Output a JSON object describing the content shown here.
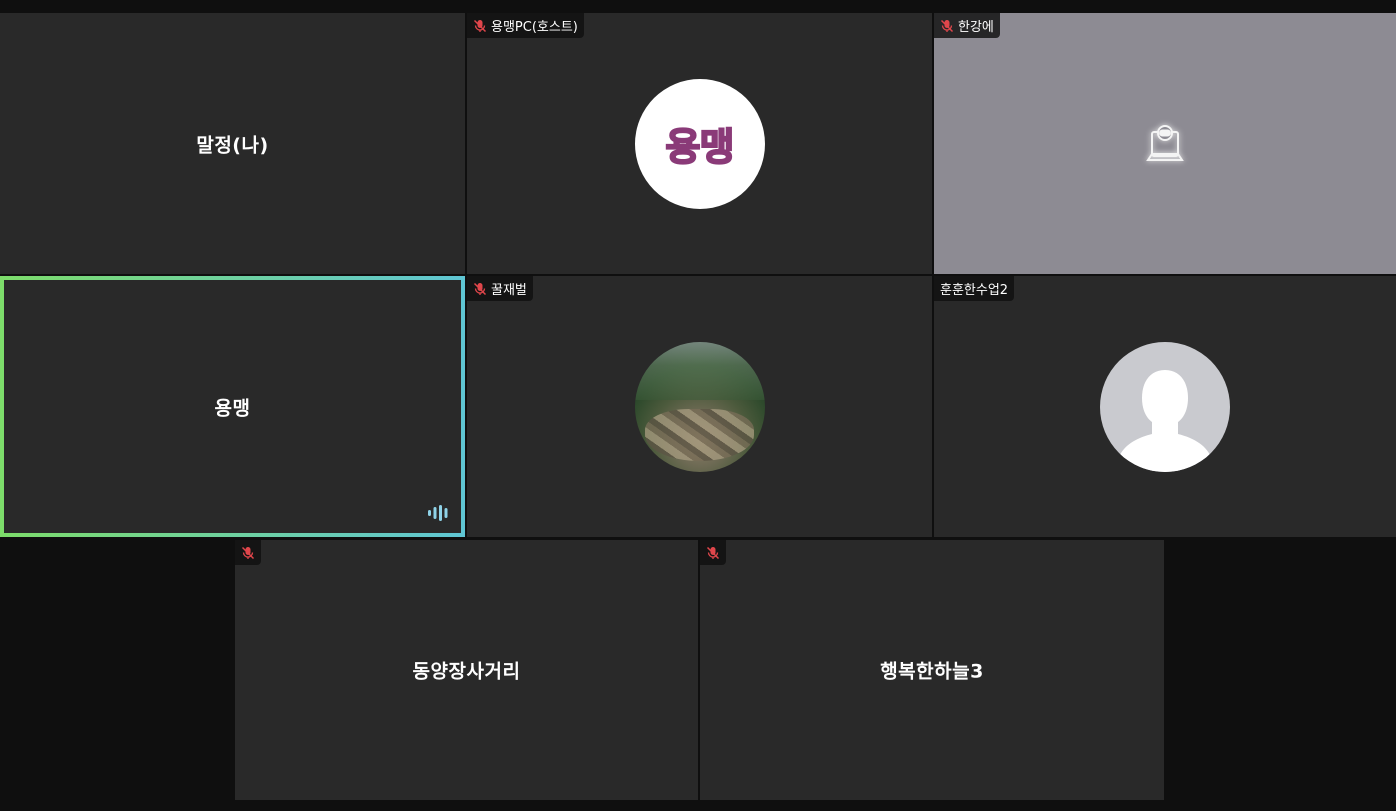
{
  "meeting": {
    "participants": [
      {
        "name": "말정(나)",
        "muted": false
      },
      {
        "name": "용맹PC(호스트)",
        "muted": true,
        "avatar_text": "용맹"
      },
      {
        "name": "한강에",
        "muted": true
      },
      {
        "name": "용맹",
        "muted": false,
        "speaking": true
      },
      {
        "name": "꿀재벌",
        "muted": true
      },
      {
        "name": "훈훈한수업2",
        "muted": false
      },
      {
        "name": "동양장사거리",
        "muted": true
      },
      {
        "name": "행복한하늘3",
        "muted": true
      }
    ]
  },
  "colors": {
    "background": "#0f0f0f",
    "tile": "#292929",
    "camera_off_tile": "#8d8b93",
    "speaking_border_start": "#7ddc6a",
    "speaking_border_end": "#5fc6d4",
    "mic_off": "#e0464b"
  }
}
